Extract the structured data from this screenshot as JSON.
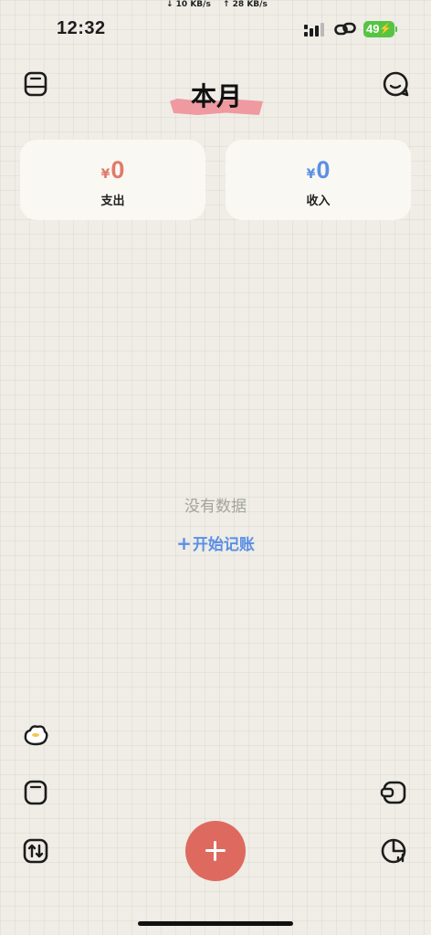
{
  "status_bar": {
    "time": "12:32",
    "download_speed": "↓ 10 KB/s",
    "upload_speed": "↑ 28 KB/s",
    "battery": "49",
    "battery_color": "#55c443"
  },
  "header": {
    "title": "本月",
    "left_icon": "book-icon",
    "right_icon": "search-icon",
    "tape_color": "#ee9aa0"
  },
  "summary": {
    "expense": {
      "currency": "¥",
      "amount": "0",
      "label": "支出",
      "color": "#e07a6a"
    },
    "income": {
      "currency": "¥",
      "amount": "0",
      "label": "收入",
      "color": "#5b8fe6"
    }
  },
  "empty_state": {
    "message": "没有数据",
    "action_plus": "+",
    "action_label": "开始记账"
  },
  "toolbar": {
    "left_icons": [
      "bun-icon",
      "notebook-icon",
      "transfer-icon"
    ],
    "right_icons": [
      "wallet-icon",
      "chart-icon"
    ],
    "fab_icon": "plus-icon",
    "fab_color": "#de6a5f"
  }
}
